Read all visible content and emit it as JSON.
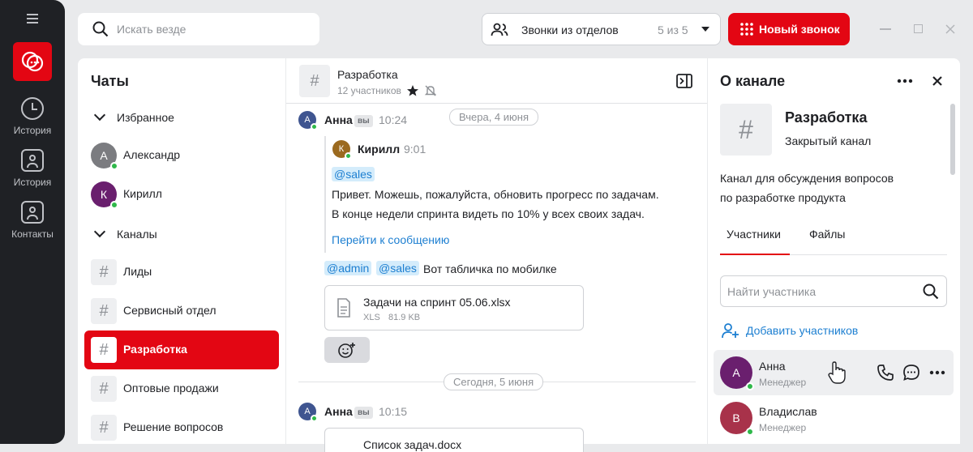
{
  "rail": {
    "items": [
      {
        "label": "История",
        "icon": "clock-icon"
      },
      {
        "label": "История",
        "icon": "contact-card-icon"
      },
      {
        "label": "Контакты",
        "icon": "contacts-icon"
      }
    ]
  },
  "search": {
    "placeholder": "Искать везде"
  },
  "calls_filter": {
    "label": "Звонки из отделов",
    "count": "5 из 5"
  },
  "new_call": {
    "label": "Новый звонок"
  },
  "chats": {
    "title": "Чаты",
    "favorites_label": "Избранное",
    "favorites": [
      {
        "name": "Александр",
        "initial": "А",
        "color": "#7b7c80"
      },
      {
        "name": "Кирилл",
        "initial": "К",
        "color": "#6a1f6e"
      }
    ],
    "channels_label": "Каналы",
    "channels": [
      {
        "name": "Лиды"
      },
      {
        "name": "Сервисный отдел"
      },
      {
        "name": "Разработка"
      },
      {
        "name": "Оптовые продажи"
      },
      {
        "name": "Решение вопросов"
      }
    ]
  },
  "channel": {
    "name": "Разработка",
    "members": "12 участников"
  },
  "messages": {
    "date1": "Вчера, 4 июня",
    "date2": "Сегодня, 5 июня",
    "m1": {
      "author": "Анна",
      "initial": "А",
      "you": "вы",
      "time": "10:24"
    },
    "quote": {
      "author": "Кирилл",
      "initial": "К",
      "time": "9:01",
      "mention": "@sales",
      "line1": "Привет. Можешь, пожалуйста, обновить прогресс по задачам.",
      "line2": "В конце недели спринта видеть по 10% у всех своих задач.",
      "link": "Перейти к сообщению"
    },
    "m1_mention1": "@admin",
    "m1_mention2": "@sales",
    "m1_text": "Вот табличка по мобилке",
    "file": {
      "name": "Задачи на спринт 05.06.xlsx",
      "type": "XLS",
      "size": "81.9 KB"
    },
    "m2": {
      "author": "Анна",
      "initial": "А",
      "you": "вы",
      "time": "10:15"
    },
    "file2": {
      "name": "Список задач.docx"
    }
  },
  "info": {
    "title": "О канале",
    "name": "Разработка",
    "type": "Закрытый канал",
    "desc1": "Канал для обсуждения вопросов",
    "desc2": "по разработке продукта",
    "tabs": [
      "Участники",
      "Файлы"
    ],
    "member_search_placeholder": "Найти участника",
    "add_members": "Добавить участников",
    "members": [
      {
        "name": "Анна",
        "role": "Менеджер",
        "initial": "А",
        "color": "#6a1f6e"
      },
      {
        "name": "Владислав",
        "role": "Менеджер",
        "initial": "В",
        "color": "#a8324a"
      }
    ]
  },
  "colors": {
    "accent": "#e30613",
    "link": "#1d7fd1",
    "online": "#2fb84a"
  }
}
